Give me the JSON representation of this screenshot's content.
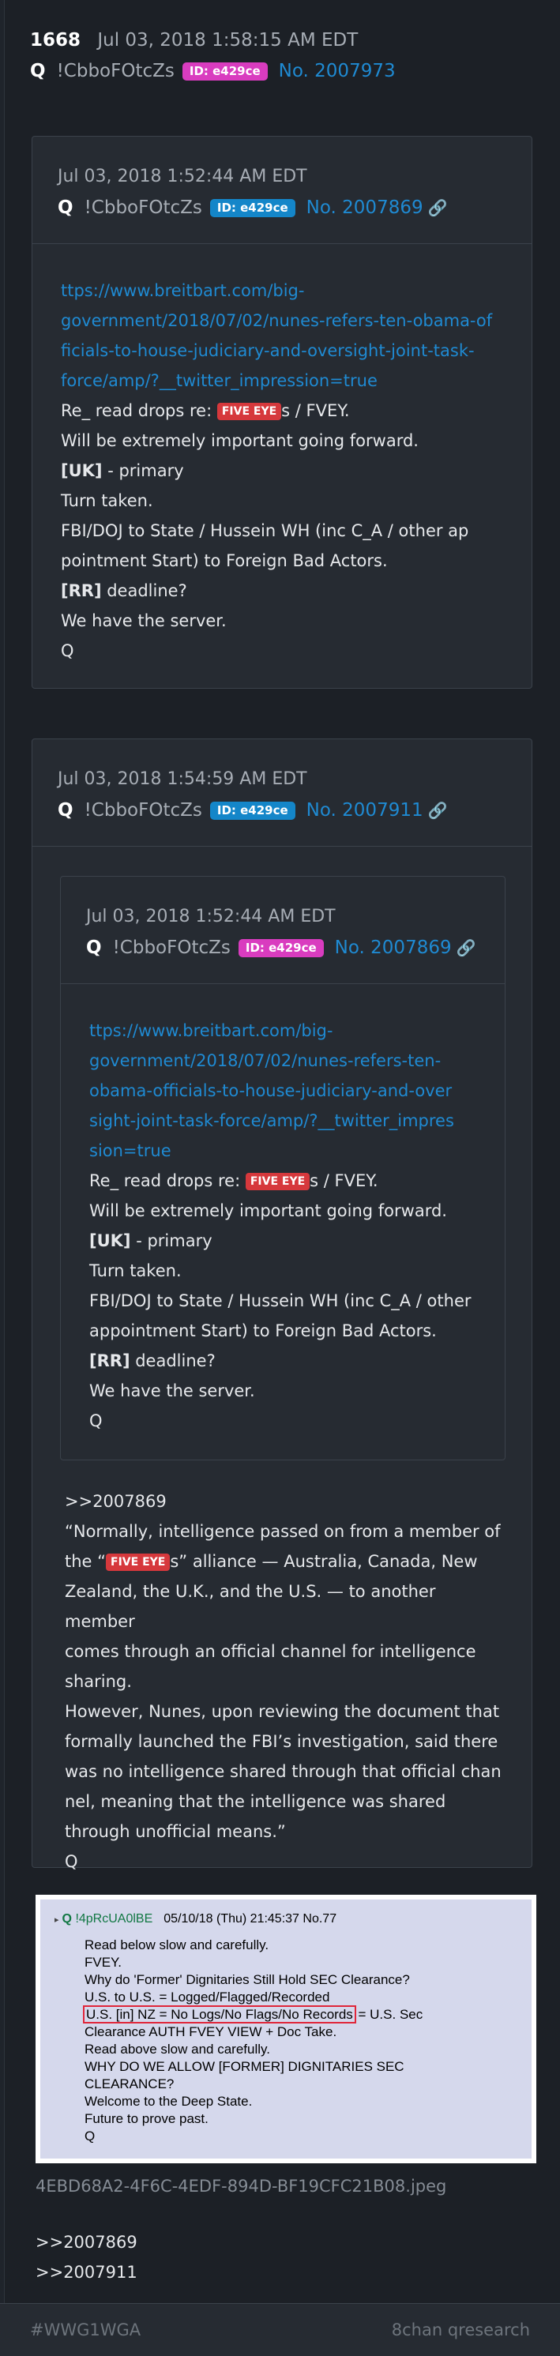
{
  "post": {
    "number": "1668",
    "date": "Jul 03, 2018 1:58:15 AM EDT",
    "author": "Q",
    "tripcode": "!CbboFOtcZs",
    "id_badge": "ID: e429ce",
    "post_no": "No. 2007973"
  },
  "card1": {
    "date": "Jul 03, 2018 1:52:44 AM EDT",
    "author": "Q",
    "tripcode": "!CbboFOtcZs",
    "id_badge": "ID: e429ce",
    "post_no": "No. 2007869",
    "url_lines": [
      "ttps://www.breitbart.com/big-",
      "government/2018/07/02/nunes-refers-ten-obama-of",
      "ficials-to-house-judiciary-and-oversight-joint-task-",
      "force/amp/?__twitter_impression=true"
    ],
    "re_pre": "Re_ read drops re: ",
    "five_eye": "FIVE EYE",
    "re_post": "s / FVEY.",
    "l1": "Will be extremely important going forward.",
    "uk_b": "[UK]",
    "uk_rest": " - primary",
    "l2": "Turn taken.",
    "l3a": "FBI/DOJ to State / Hussein WH (inc C_A / other ap",
    "l3b": "pointment Start) to Foreign Bad Actors.",
    "rr_b": "[RR]",
    "rr_rest": " deadline?",
    "l4": "We have the server.",
    "sig": "Q"
  },
  "card2": {
    "date": "Jul 03, 2018 1:54:59 AM EDT",
    "author": "Q",
    "tripcode": "!CbboFOtcZs",
    "id_badge": "ID: e429ce",
    "post_no": "No. 2007911"
  },
  "card3": {
    "date": "Jul 03, 2018 1:52:44 AM EDT",
    "author": "Q",
    "tripcode": "!CbboFOtcZs",
    "id_badge": "ID: e429ce",
    "post_no": "No. 2007869",
    "url_lines": [
      "ttps://www.breitbart.com/big-",
      "government/2018/07/02/nunes-refers-ten-",
      "obama-officials-to-house-judiciary-and-over",
      "sight-joint-task-force/amp/?__twitter_impres",
      "sion=true"
    ],
    "re_pre": "Re_ read drops re: ",
    "five_eye": "FIVE EYE",
    "re_post": "s / FVEY.",
    "l1": "Will be extremely important going forward.",
    "uk_b": "[UK]",
    "uk_rest": " - primary",
    "l2": "Turn taken.",
    "l3a": "FBI/DOJ to State / Hussein WH (inc C_A / other",
    "l3b": "appointment Start) to Foreign Bad Actors.",
    "rr_b": "[RR]",
    "rr_rest": " deadline?",
    "l4": "We have the server.",
    "sig": "Q"
  },
  "quote": {
    "ref": ">>2007869",
    "p1_pre": "“Normally, intelligence passed on from a member of",
    "p1_the": "the “",
    "five_eye": "FIVE EYE",
    "p1_post": "s” alliance — Australia, Canada, New",
    "p1_l3": "Zealand, the U.K., and the U.S. — to another member",
    "p1_l4": "comes through an official channel for intelligence",
    "p1_l5": "sharing.",
    "p2_l1": "However, Nunes, upon reviewing the document that",
    "p2_l2": "formally launched the FBI’s investigation, said there",
    "p2_l3": "was no intelligence shared through that official chan",
    "p2_l4": "nel, meaning that the intelligence was shared",
    "p2_l5": "through unofficial means.”",
    "sig": "Q"
  },
  "image": {
    "hdr_tri": "▸",
    "hdr_q": "Q",
    "hdr_trip": "!4pRcUA0lBE",
    "hdr_date": "05/10/18 (Thu) 21:45:37 No.77",
    "lines": [
      "Read below slow and carefully.",
      "FVEY.",
      "Why do 'Former' Dignitaries Still Hold SEC Clearance?",
      "U.S. to U.S. = Logged/Flagged/Recorded"
    ],
    "boxed": "U.S. [in] NZ = No Logs/No Flags/No Records",
    "boxed_rest": " = U.S. Sec",
    "lines2": [
      "Clearance AUTH FVEY VIEW + Doc Take.",
      "Read above slow and carefully.",
      "WHY DO WE ALLOW [FORMER] DIGNITARIES SEC",
      "CLEARANCE?",
      "Welcome to the Deep State.",
      "Future to prove past.",
      "Q"
    ],
    "filename": "4EBD68A2-4F6C-4EDF-894D-BF19CFC21B08.jpeg"
  },
  "refs": [
    ">>2007869",
    ">>2007911"
  ],
  "footer": {
    "left": "#WWG1WGA",
    "right": "8chan qresearch"
  },
  "colors": {
    "bg": "#1f242b",
    "link": "#1f8ad2",
    "id_pink": "#d93cbf",
    "id_blue": "#1486c9",
    "five_eye_red": "#d6383c"
  }
}
